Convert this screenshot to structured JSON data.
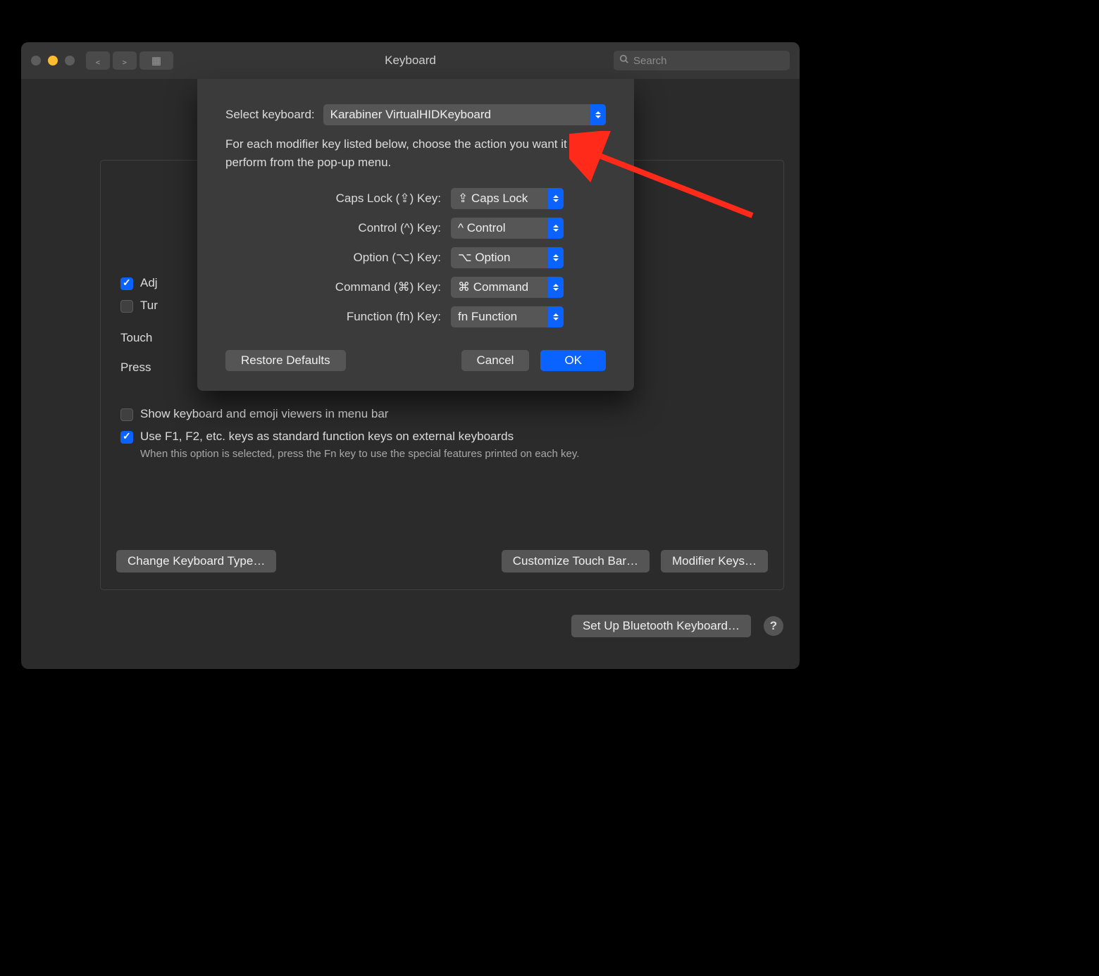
{
  "titlebar": {
    "title": "Keyboard",
    "search_placeholder": "Search"
  },
  "background": {
    "adj_label": "Adj",
    "adj_checked": true,
    "turn_label": "Tur",
    "turn_checked": false,
    "touch_label": "Touch",
    "press_label": "Press",
    "show_viewers_label": "Show keyboard and emoji viewers in menu bar",
    "show_viewers_checked": false,
    "use_fkeys_label": "Use F1, F2, etc. keys as standard function keys on external keyboards",
    "use_fkeys_checked": true,
    "use_fkeys_sub": "When this option is selected, press the Fn key to use the special features printed on each key.",
    "change_type_btn": "Change Keyboard Type…",
    "customize_touchbar_btn": "Customize Touch Bar…",
    "modifier_keys_btn": "Modifier Keys…",
    "setup_bt_btn": "Set Up Bluetooth Keyboard…"
  },
  "sheet": {
    "select_label": "Select keyboard:",
    "select_value": "Karabiner VirtualHIDKeyboard",
    "description": "For each modifier key listed below, choose the action you want it to perform from the pop-up menu.",
    "rows": [
      {
        "label": "Caps Lock (⇪) Key:",
        "value": "⇪ Caps Lock"
      },
      {
        "label": "Control (^) Key:",
        "value": "^ Control"
      },
      {
        "label": "Option (⌥) Key:",
        "value": "⌥ Option"
      },
      {
        "label": "Command (⌘) Key:",
        "value": "⌘ Command"
      },
      {
        "label": "Function (fn) Key:",
        "value": "fn Function"
      }
    ],
    "restore_btn": "Restore Defaults",
    "cancel_btn": "Cancel",
    "ok_btn": "OK"
  }
}
